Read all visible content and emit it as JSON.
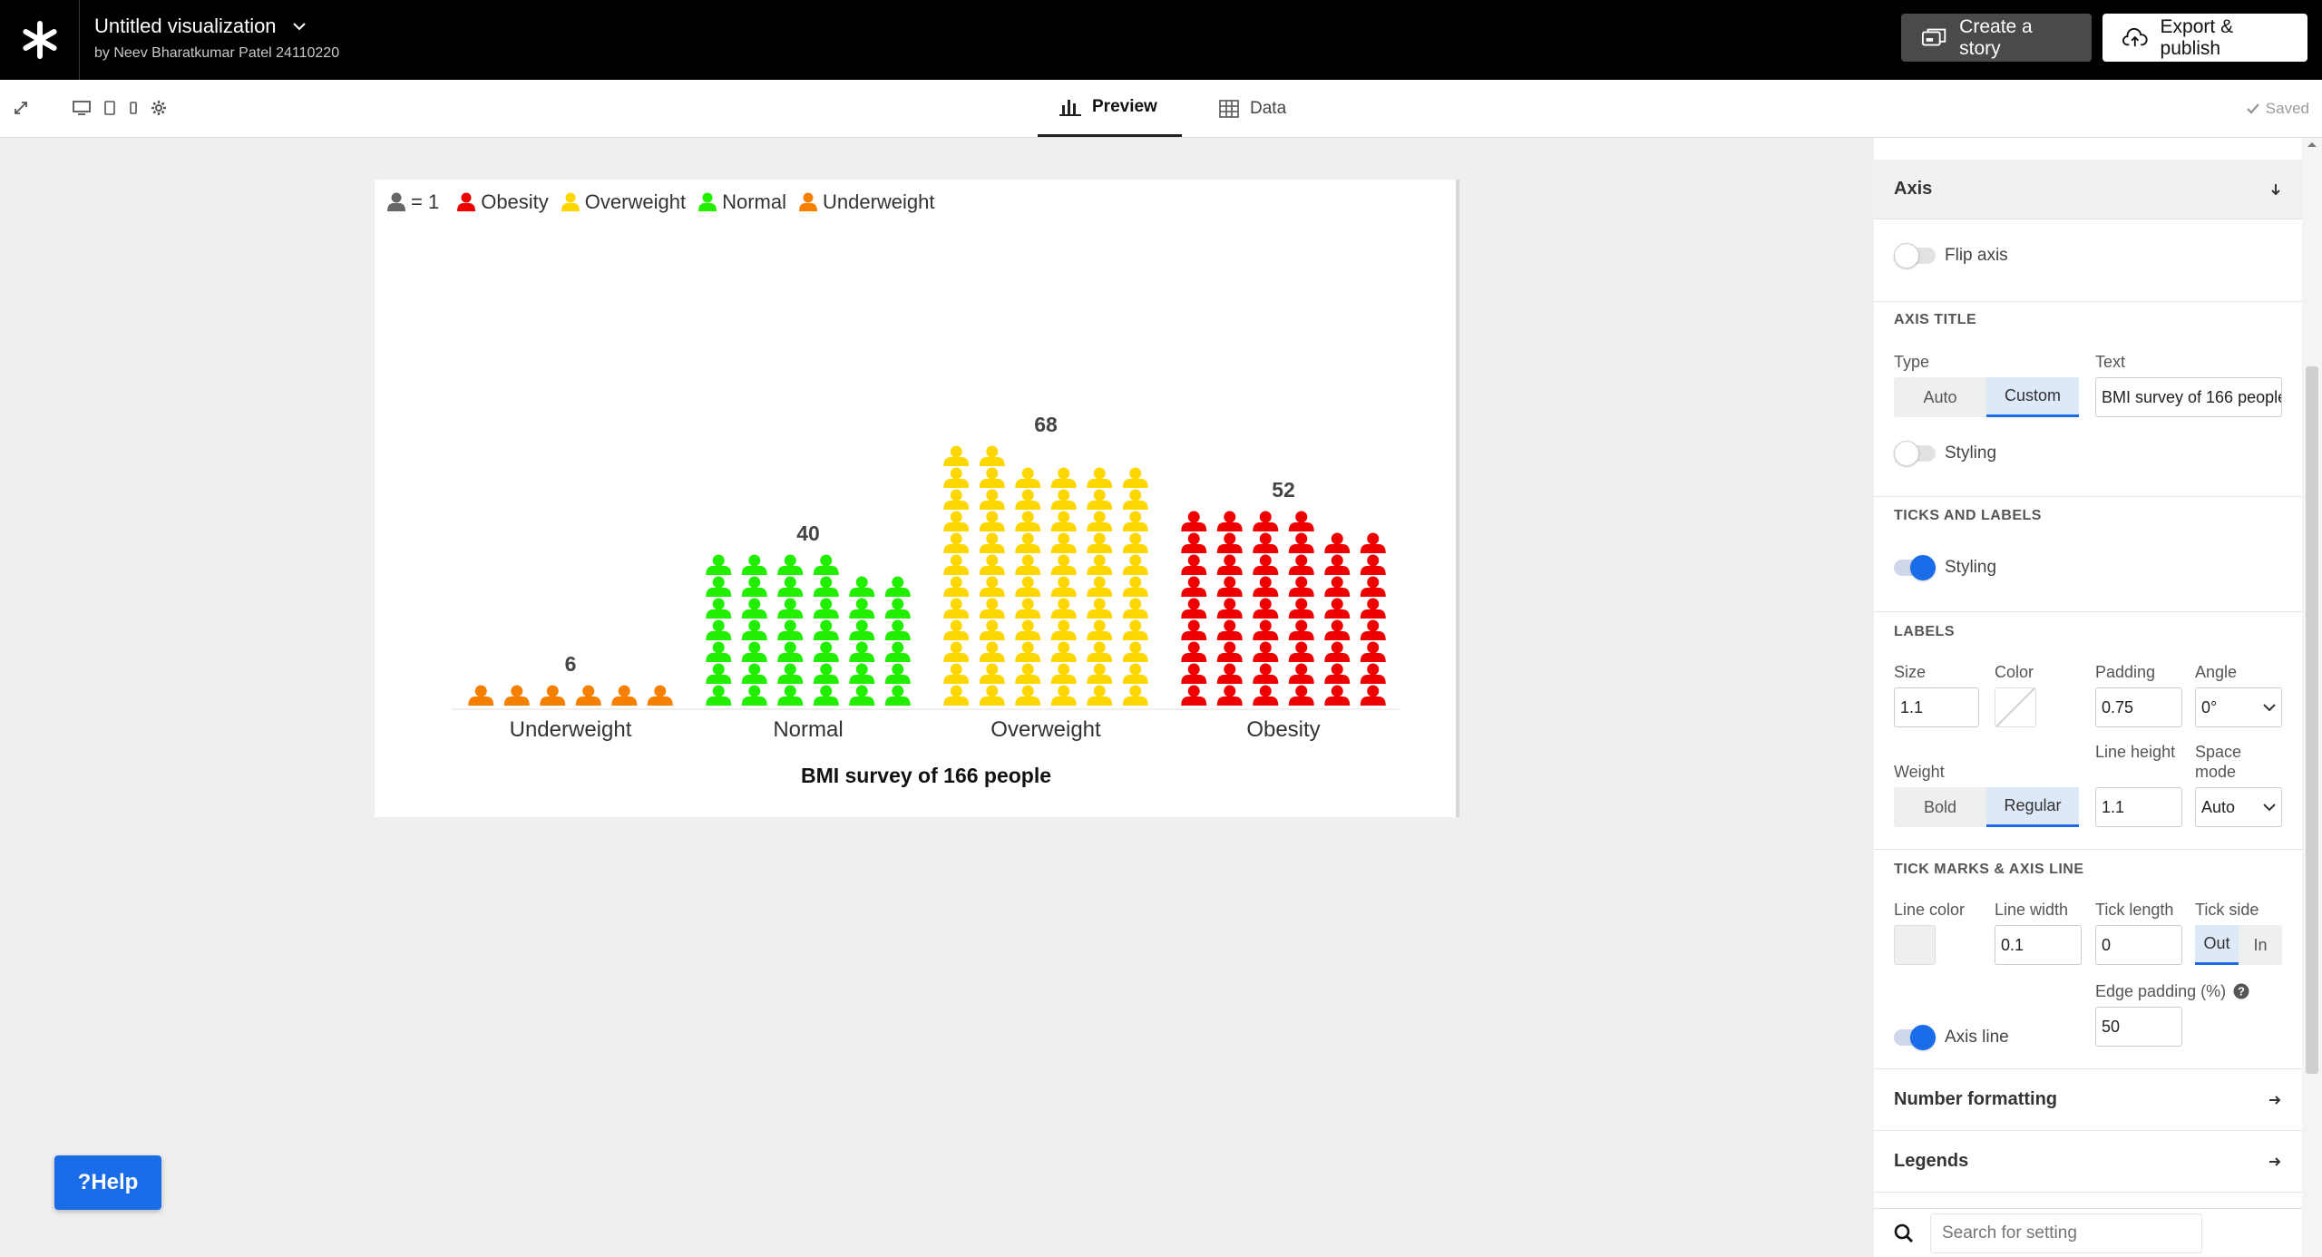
{
  "header": {
    "title": "Untitled visualization",
    "author": "by Neev Bharatkumar Patel 24110220",
    "create_story": "Create a story",
    "export_publish": "Export & publish"
  },
  "toolbar": {
    "preview_tab": "Preview",
    "data_tab": "Data",
    "saved": "Saved"
  },
  "colors": {
    "obesity": "#ee0000",
    "overweight": "#ffd700",
    "normal": "#22ee00",
    "underweight": "#f57f00",
    "key": "#666666",
    "accent": "#1a6ce8"
  },
  "chart_data": {
    "type": "pictogram",
    "unit_label": "= 1",
    "legend": [
      "Obesity",
      "Overweight",
      "Normal",
      "Underweight"
    ],
    "categories": [
      "Underweight",
      "Normal",
      "Overweight",
      "Obesity"
    ],
    "values": [
      6,
      40,
      68,
      52
    ],
    "columns_per_category": 6,
    "xlabel": "BMI survey of 166 people"
  },
  "panel": {
    "axis_section": "Axis",
    "flip_axis": "Flip axis",
    "axis_title": {
      "heading": "AXIS TITLE",
      "type_label": "Type",
      "type_options": [
        "Auto",
        "Custom"
      ],
      "type_selected": "Custom",
      "text_label": "Text",
      "text_value": "BMI survey of 166 people",
      "styling": "Styling"
    },
    "ticks_and_labels": {
      "heading": "TICKS AND LABELS",
      "styling": "Styling"
    },
    "labels": {
      "heading": "LABELS",
      "size_label": "Size",
      "size_value": "1.1",
      "color_label": "Color",
      "padding_label": "Padding",
      "padding_value": "0.75",
      "angle_label": "Angle",
      "angle_value": "0°",
      "weight_label": "Weight",
      "weight_options": [
        "Bold",
        "Regular"
      ],
      "weight_selected": "Regular",
      "line_height_label": "Line height",
      "line_height_value": "1.1",
      "space_mode_label": "Space mode",
      "space_mode_value": "Auto"
    },
    "tick_marks": {
      "heading": "TICK MARKS & AXIS LINE",
      "line_color_label": "Line color",
      "line_width_label": "Line width",
      "line_width_value": "0.1",
      "tick_length_label": "Tick length",
      "tick_length_value": "0",
      "tick_side_label": "Tick side",
      "tick_side_options": [
        "Out",
        "In"
      ],
      "tick_side_selected": "Out",
      "edge_padding_label": "Edge padding (%)",
      "edge_padding_value": "50",
      "axis_line": "Axis line"
    },
    "number_formatting": "Number formatting",
    "legends": "Legends",
    "search_placeholder": "Search for setting"
  },
  "help": "Help"
}
